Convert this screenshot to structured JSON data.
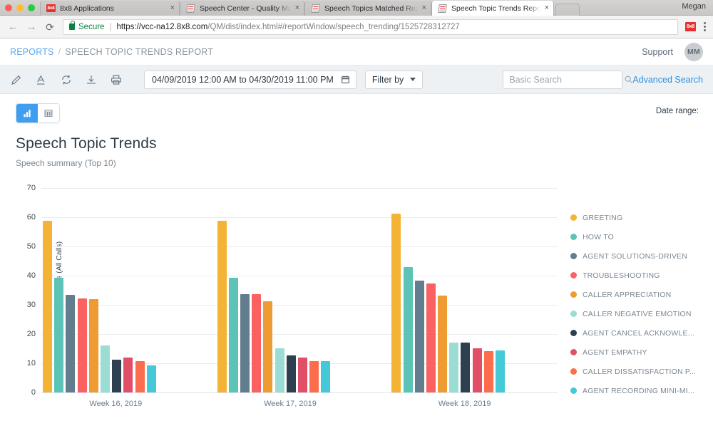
{
  "browser": {
    "tabs": [
      {
        "title": "8x8 Applications",
        "favicon": "8x8-icon",
        "active": false
      },
      {
        "title": "Speech Center - Quality Mana",
        "favicon": "document-icon",
        "active": false
      },
      {
        "title": "Speech Topics Matched Repor",
        "favicon": "document-icon",
        "active": false
      },
      {
        "title": "Speech Topic Trends Report -",
        "favicon": "document-icon",
        "active": true
      }
    ],
    "close_glyph": "×",
    "user": "Megan",
    "nav": {
      "back": "←",
      "forward": "→",
      "reload": "⟳"
    },
    "omnibox": {
      "secure_label": "Secure",
      "url_host": "https://vcc-na12.8x8.com",
      "url_path": "/QM/dist/index.html#/reportWindow/speech_trending/1525728312727"
    },
    "extension_label": "8x8"
  },
  "app": {
    "breadcrumb": {
      "root": "REPORTS",
      "separator": "/",
      "current": "SPEECH TOPIC TRENDS REPORT"
    },
    "support_label": "Support",
    "avatar_initials": "MM"
  },
  "toolbar": {
    "icons": [
      "edit-pencil-icon",
      "text-format-icon",
      "refresh-icon",
      "download-icon",
      "print-icon"
    ],
    "date_range_value": "04/09/2019 12:00 AM to 04/30/2019 11:00 PM",
    "filter_label": "Filter by",
    "search_placeholder": "Basic Search",
    "search_value": "",
    "advanced_search_label": "Advanced Search"
  },
  "view": {
    "toggle": [
      {
        "name": "chart-view",
        "icon": "bar-chart-icon",
        "active": true
      },
      {
        "name": "table-view",
        "icon": "table-grid-icon",
        "active": false
      }
    ],
    "date_range_label": "Date range:",
    "title": "Speech Topic Trends",
    "subtitle": "Speech summary (Top 10)"
  },
  "colors": {
    "accent_blue": "#3f9ef0",
    "link_blue": "#2f8fe0",
    "breadcrumb_blue": "#5aaaf3",
    "secure_green": "#0b8043",
    "brand_red": "#e8312f"
  },
  "chart_data": {
    "type": "bar",
    "title": "Speech Topic Trends",
    "subtitle": "Speech summary (Top 10)",
    "xlabel": "",
    "ylabel": "% of Matched Calls (All Calls)",
    "ylim": [
      0,
      70
    ],
    "yticks": [
      0,
      10,
      20,
      30,
      40,
      50,
      60,
      70
    ],
    "grid": true,
    "legend_position": "right",
    "categories": [
      "Week 16, 2019",
      "Week 17, 2019",
      "Week 18, 2019"
    ],
    "series": [
      {
        "name": "GREETING",
        "color": "#f5b335",
        "values": [
          58.8,
          58.8,
          61.2
        ]
      },
      {
        "name": "HOW TO",
        "color": "#5bc4b6",
        "values": [
          39.3,
          39.3,
          43.0
        ]
      },
      {
        "name": "AGENT SOLUTIONS-DRIVEN",
        "color": "#627d8d",
        "values": [
          33.5,
          33.7,
          38.4
        ]
      },
      {
        "name": "TROUBLESHOOTING",
        "color": "#fc6161",
        "values": [
          32.2,
          33.7,
          37.3
        ]
      },
      {
        "name": "CALLER APPRECIATION",
        "color": "#ee9b31",
        "values": [
          31.9,
          31.2,
          33.2
        ]
      },
      {
        "name": "CALLER NEGATIVE EMOTION",
        "color": "#9bddd4",
        "values": [
          16.2,
          15.2,
          17.0
        ]
      },
      {
        "name": "AGENT CANCEL ACKNOWLE...",
        "color": "#2e3f50",
        "values": [
          11.2,
          12.6,
          17.0
        ]
      },
      {
        "name": "AGENT EMPATHY",
        "color": "#e04f67",
        "values": [
          12.0,
          12.0,
          15.2
        ]
      },
      {
        "name": "CALLER DISSATISFACTION P...",
        "color": "#fb6d4c",
        "values": [
          10.7,
          10.7,
          14.2
        ]
      },
      {
        "name": "AGENT RECORDING MINI-MI...",
        "color": "#45c8d8",
        "values": [
          9.2,
          10.8,
          14.4
        ]
      }
    ]
  }
}
